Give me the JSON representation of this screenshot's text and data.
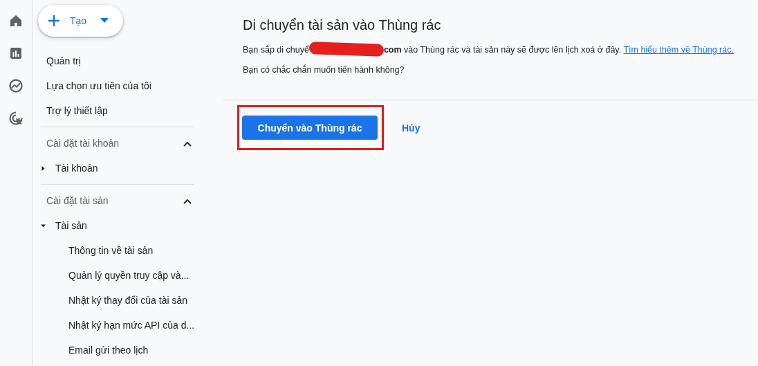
{
  "nav_rail": [
    {
      "kind": "home",
      "selected": false
    },
    {
      "kind": "reports",
      "selected": false
    },
    {
      "kind": "explore",
      "selected": false
    },
    {
      "kind": "advertising",
      "selected": false
    }
  ],
  "create_button": {
    "label": "Tạo"
  },
  "sidebar": {
    "items": [
      {
        "label": "Quản trị"
      },
      {
        "label": "Lựa chọn ưu tiên của tôi"
      },
      {
        "label": "Trợ lý thiết lập"
      }
    ],
    "sections": [
      {
        "title": "Cài đặt tài khoản",
        "expanded": true,
        "children": [
          {
            "label": "Tài khoản",
            "expanded": false
          }
        ]
      },
      {
        "title": "Cài đặt tài sản",
        "expanded": true,
        "children": [
          {
            "label": "Tài sản",
            "expanded": true,
            "children": [
              {
                "label": "Thông tin về tài sản"
              },
              {
                "label": "Quản lý quyền truy cập và..."
              },
              {
                "label": "Nhật ký thay đổi của tài sản"
              },
              {
                "label": "Nhật ký hạn mức API của d..."
              },
              {
                "label": "Email gửi theo lịch"
              }
            ]
          }
        ]
      }
    ]
  },
  "dialog": {
    "title": "Di chuyển tài sản vào Thùng rác",
    "message": {
      "before": "Bạn sắp di chuyể",
      "redacted": true,
      "after": "**com** vào Thùng rác và tài sản này sẽ được lên lịch xoá ở đây.",
      "link": "Tìm hiểu thêm về Thùng rác."
    },
    "question": "Bạn có chắc chắn muốn tiến hành không?",
    "primary_button": {
      "label": "Chuyển vào Thùng rác",
      "highlighted": true
    },
    "cancel_button": {
      "label": "Hủy"
    }
  }
}
